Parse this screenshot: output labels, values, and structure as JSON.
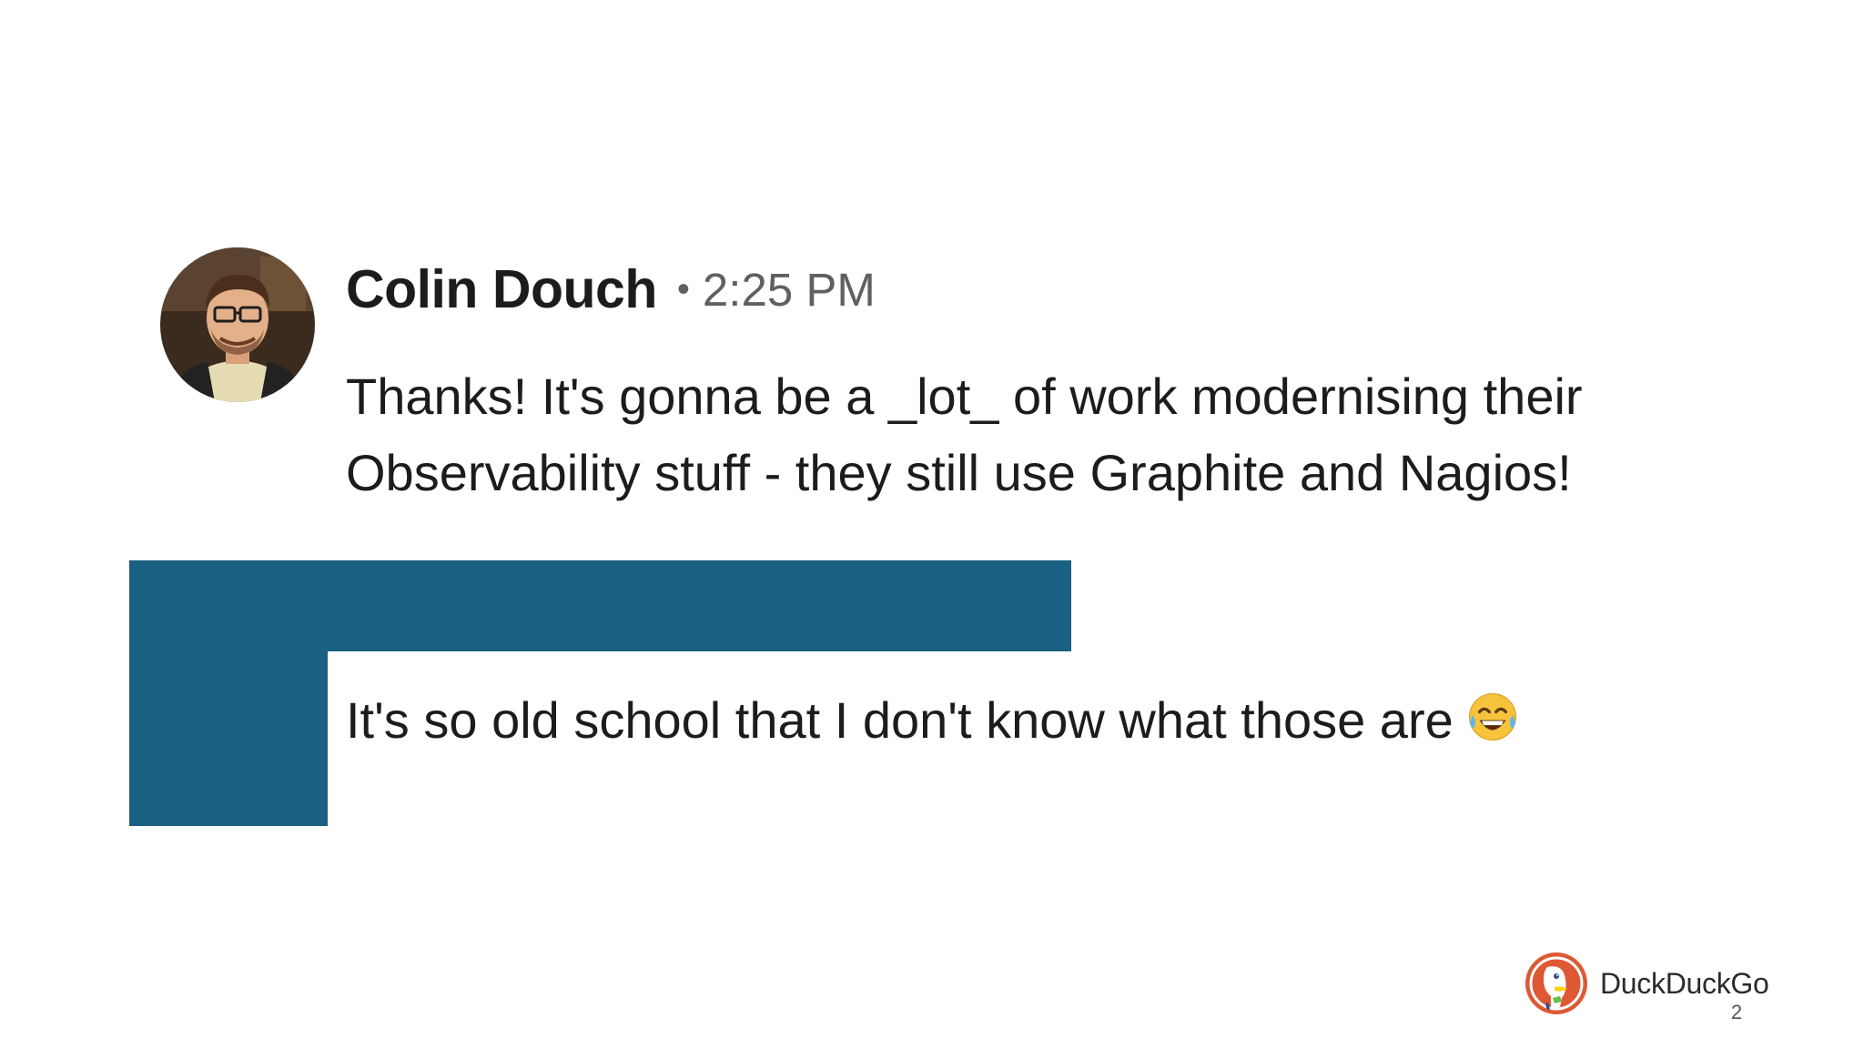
{
  "message": {
    "author": "Colin Douch",
    "separator": "•",
    "timestamp": "2:25 PM",
    "lines": [
      "Thanks! It's gonna be a _lot_ of work modernising their",
      "Observability stuff - they still use Graphite and Nagios!"
    ],
    "avatar_icon": "user-photo-avatar"
  },
  "reply": {
    "text": "It's so old school that I don't know what those are",
    "emoji_icon": "face-with-tears-of-joy-icon"
  },
  "redaction": {
    "color": "#1a6082"
  },
  "footer": {
    "brand_name": "DuckDuckGo",
    "brand_icon": "duckduckgo-logo-icon",
    "page_number": "2"
  }
}
